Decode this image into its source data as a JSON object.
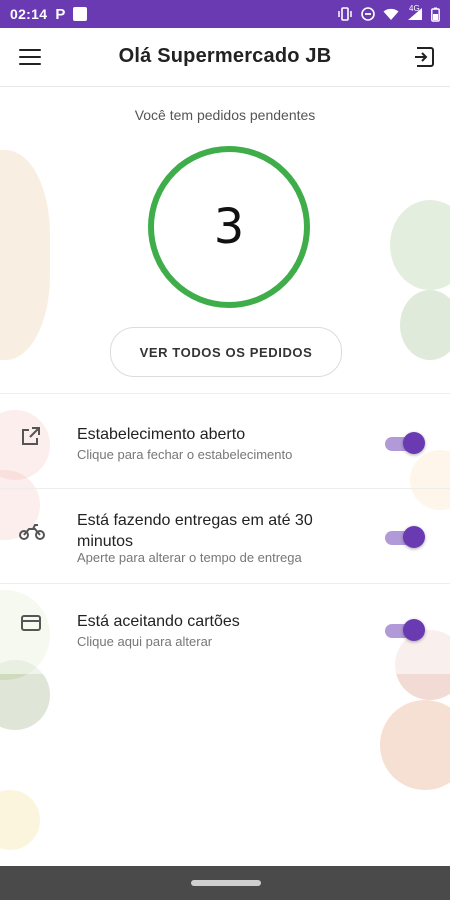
{
  "status_bar": {
    "time": "02:14",
    "p_label": "P",
    "network": "4G",
    "icons": [
      "vibrate-icon",
      "dnd-icon",
      "wifi-icon",
      "signal-icon",
      "battery-icon"
    ]
  },
  "app_bar": {
    "title": "Olá Supermercado JB",
    "menu_icon": "menu-icon",
    "logout_icon": "logout-icon"
  },
  "main": {
    "pending_text": "Você tem pedidos pendentes",
    "pending_count": "3",
    "view_all_button": "VER TODOS OS PEDIDOS"
  },
  "settings": [
    {
      "icon": "open-external-icon",
      "title": "Estabelecimento aberto",
      "subtitle": "Clique para fechar o estabelecimento",
      "enabled": true
    },
    {
      "icon": "motorcycle-icon",
      "title": "Está fazendo entregas em até 30 minutos",
      "subtitle": "Aperte para alterar o tempo de entrega",
      "enabled": true
    },
    {
      "icon": "credit-card-icon",
      "title": "Está aceitando cartões",
      "subtitle": "Clique aqui para alterar",
      "enabled": true
    }
  ],
  "colors": {
    "primary": "#6a3ab2",
    "switch_track": "#b29ad9",
    "ring_green": "#3fae4a"
  }
}
